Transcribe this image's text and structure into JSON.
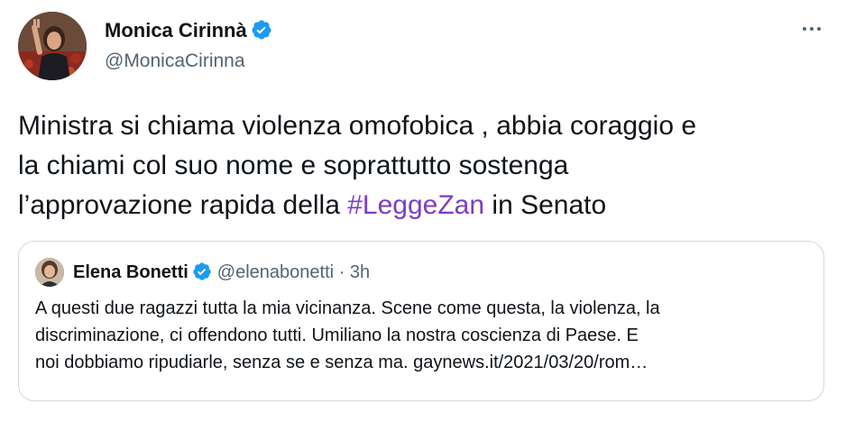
{
  "author": {
    "name": "Monica Cirinnà",
    "handle": "@MonicaCirinna",
    "verified": true
  },
  "tweet": {
    "lines": [
      "Ministra si chiama violenza omofobica , abbia coraggio e",
      "la chiami col suo nome e soprattutto sostenga",
      "l’approvazione rapida della "
    ],
    "hashtag": "#LeggeZan",
    "tail": " in Senato"
  },
  "quote": {
    "author_name": "Elena Bonetti",
    "author_handle": "@elenabonetti",
    "separator": "·",
    "time": "3h",
    "verified": true,
    "lines": [
      "A questi due ragazzi tutta la mia vicinanza. Scene come questa, la violenza, la",
      "discriminazione, ci offendono tutti. Umiliano la nostra coscienza di Paese. E",
      "noi dobbiamo ripudiarle, senza se e senza ma. gaynews.it/2021/03/20/rom…"
    ]
  },
  "colors": {
    "hashtag": "#7c3dc7",
    "verified": "#1d9bf0",
    "secondary_text": "#536471",
    "border": "#cfd9de"
  },
  "icons": {
    "verified": "verified-badge-icon",
    "more": "more-dots-icon"
  }
}
